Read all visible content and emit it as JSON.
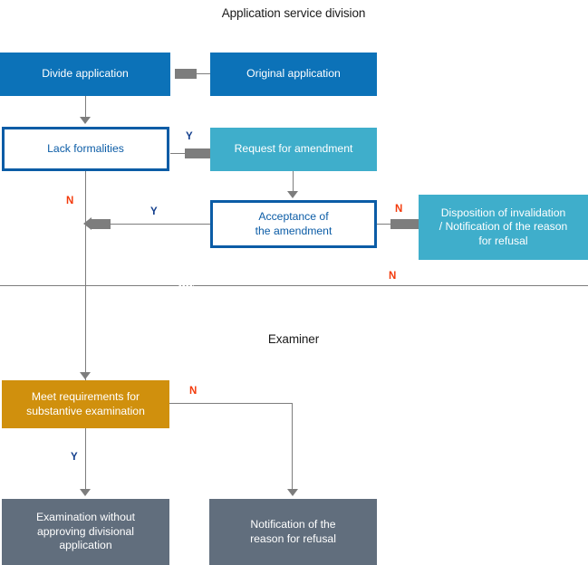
{
  "diagram": {
    "title_top": "Application service division",
    "title_mid": "Examiner",
    "colors": {
      "blue": "#0C72B8",
      "teal": "#3FAECB",
      "orange": "#D0900D",
      "slate": "#616E7D",
      "outline_blue": "#0B5CA6",
      "connector_grey": "#7D7D7D",
      "label_no": "#F33A0B",
      "label_yes": "#123E8C"
    },
    "nodes": {
      "divide_application": "Divide application",
      "original_application": "Original application",
      "lack_formalities": "Lack formalities",
      "request_for_amendment": "Request for amendment",
      "acceptance_of_amendment": "Acceptance of\nthe amendment",
      "disposition_invalidation": "Disposition of invalidation\n/ Notification of the reason\nfor refusal",
      "meet_requirements": "Meet requirements for\nsubstantive examination",
      "examination_without_approving": "Examination without\napproving divisional\napplication",
      "notification_reason_refusal": "Notification of the\nreason for refusal"
    },
    "branch_labels": {
      "lack_formalities_yes": "Y",
      "lack_formalities_no": "N",
      "acceptance_yes": "Y",
      "acceptance_no": "N",
      "lane_cross_no": "N",
      "meet_requirements_no": "N",
      "meet_requirements_yes": "Y"
    }
  }
}
